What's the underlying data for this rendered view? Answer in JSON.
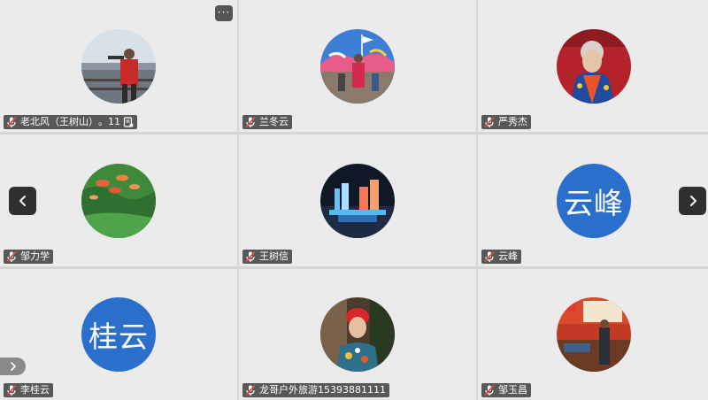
{
  "toolbar": {
    "more_label": "···"
  },
  "tiles": [
    {
      "name": "老北风（王树山）",
      "suffix": "。11",
      "avatar": "photo-harbor",
      "has_extra_icon": true
    },
    {
      "name": "兰冬云",
      "avatar": "photo-festival"
    },
    {
      "name": "严秀杰",
      "avatar": "photo-elder-woman"
    },
    {
      "name": "邹力学",
      "avatar": "photo-fish"
    },
    {
      "name": "王树信",
      "avatar": "photo-night-lights"
    },
    {
      "name": "云峰",
      "avatar_text": "云峰",
      "avatar_color": "#2a6fcb"
    },
    {
      "name": "李桂云",
      "avatar_text": "桂云",
      "avatar_color": "#2a6fcb"
    },
    {
      "name": "龙哥户外旅游15393881111",
      "avatar": "photo-man-red-hair"
    },
    {
      "name": "邹玉昌",
      "avatar": "photo-man-standing"
    }
  ],
  "icons": {
    "mic": "mic-muted-icon",
    "extra": "document-icon",
    "prev": "chevron-left-icon",
    "next": "chevron-right-icon",
    "collapse": "chevron-right-icon"
  },
  "colors": {
    "tile_bg": "#ebebeb",
    "text_avatar": "#2a6fcb",
    "muted_mic": "#e2483d"
  }
}
